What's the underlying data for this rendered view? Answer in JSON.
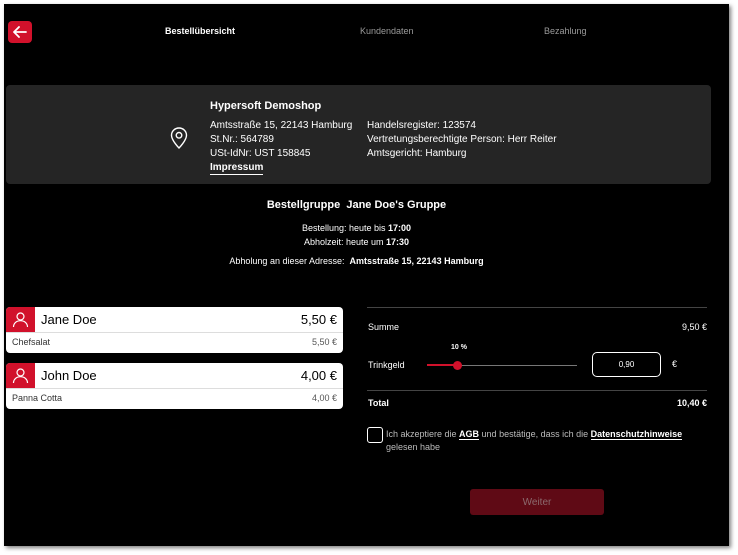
{
  "steps": [
    {
      "label": "Bestellübersicht"
    },
    {
      "label": "Kundendaten"
    },
    {
      "label": "Bezahlung"
    }
  ],
  "shop": {
    "name": "Hypersoft Demoshop",
    "address": "Amtsstraße 15, 22143 Hamburg",
    "tax_no": "St.Nr.:  564789",
    "vat_id": "USt-IdNr:  UST 158845",
    "impressum_label": "Impressum",
    "register": "Handelsregister:  123574",
    "representative": "Vertretungsberechtigte Person:  Herr Reiter",
    "court": "Amtsgericht:  Hamburg"
  },
  "group": {
    "label": "Bestellgruppe",
    "name": "Jane Doe's Gruppe",
    "order_prefix": "Bestellung: heute bis ",
    "order_time": "17:00",
    "pickup_prefix": "Abholzeit: heute um ",
    "pickup_time": "17:30",
    "address_prefix": "Abholung an dieser Adresse:",
    "address": "Amtsstraße 15, 22143 Hamburg"
  },
  "orders": [
    {
      "name": "Jane Doe",
      "total": "5,50 €",
      "item": "Chefsalat",
      "item_price": "5,50 €"
    },
    {
      "name": "John Doe",
      "total": "4,00 €",
      "item": "Panna Cotta",
      "item_price": "4,00 €"
    }
  ],
  "summary": {
    "sum_label": "Summe",
    "sum_value": "9,50 €",
    "tip_label": "Trinkgeld",
    "tip_percent_label": "10 %",
    "tip_fraction": 0.2,
    "tip_value": "0,90",
    "currency": "€",
    "total_label": "Total",
    "total_value": "10,40 €"
  },
  "agree": {
    "text_before": "Ich akzeptiere die ",
    "agb": "AGB",
    "text_middle": " und bestätige, dass ich die ",
    "privacy": "Datenschutzhinweise",
    "text_after": " gelesen habe"
  },
  "next_label": "Weiter",
  "colors": {
    "accent": "#d1112b",
    "background": "#000000",
    "card": "#252525"
  }
}
